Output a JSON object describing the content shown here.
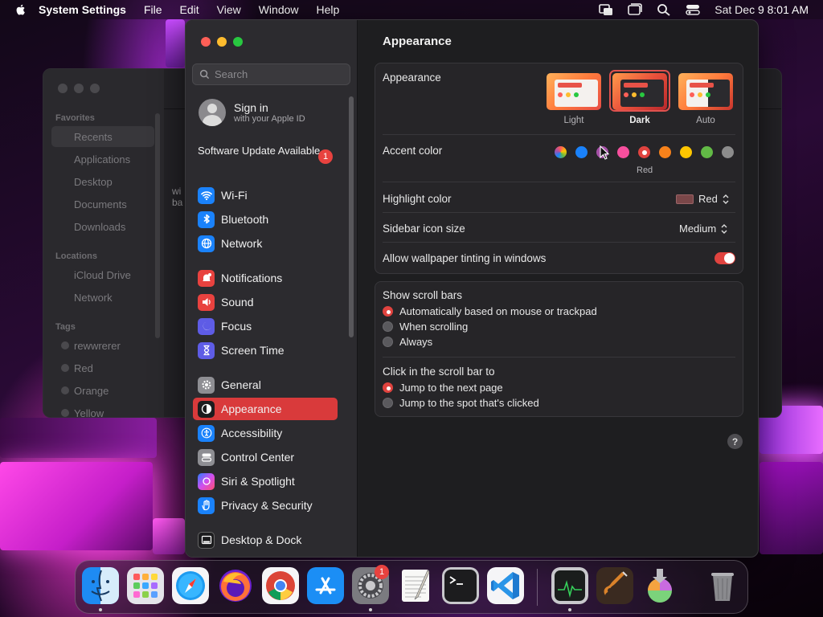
{
  "menubar": {
    "app_name": "System Settings",
    "menus": [
      "File",
      "Edit",
      "View",
      "Window",
      "Help"
    ],
    "clock": "Sat Dec 9  8:01 AM"
  },
  "finder": {
    "sections": {
      "favorites": "Favorites",
      "locations": "Locations",
      "tags": "Tags"
    },
    "favorites": [
      "Recents",
      "Applications",
      "Desktop",
      "Documents",
      "Downloads"
    ],
    "locations": [
      "iCloud Drive",
      "Network"
    ],
    "tags": [
      "rewwrerer",
      "Red",
      "Orange",
      "Yellow"
    ],
    "content_fragment": [
      "wi",
      "ba"
    ]
  },
  "settings": {
    "search": {
      "placeholder": "Search"
    },
    "account": {
      "title": "Sign in",
      "subtitle": "with your Apple ID"
    },
    "software_update": {
      "label": "Software Update Available",
      "badge": "1"
    },
    "sidebar": {
      "items": [
        {
          "label": "Wi-Fi",
          "icon": "wifi-icon",
          "color": "#1a82fb"
        },
        {
          "label": "Bluetooth",
          "icon": "bluetooth-icon",
          "color": "#1a82fb"
        },
        {
          "label": "Network",
          "icon": "globe-icon",
          "color": "#1a82fb"
        },
        {
          "label": "Notifications",
          "icon": "bell-icon",
          "color": "#e8423f"
        },
        {
          "label": "Sound",
          "icon": "speaker-icon",
          "color": "#e8423f"
        },
        {
          "label": "Focus",
          "icon": "moon-icon",
          "color": "#5e5ce6"
        },
        {
          "label": "Screen Time",
          "icon": "hourglass-icon",
          "color": "#5e5ce6"
        },
        {
          "label": "General",
          "icon": "gear-icon",
          "color": "#8e8e93"
        },
        {
          "label": "Appearance",
          "icon": "appearance-icon",
          "color": "#1c1c1e",
          "selected": true
        },
        {
          "label": "Accessibility",
          "icon": "accessibility-icon",
          "color": "#1a82fb"
        },
        {
          "label": "Control Center",
          "icon": "control-center-icon",
          "color": "#8e8e93"
        },
        {
          "label": "Siri & Spotlight",
          "icon": "siri-icon",
          "color": "#b04cd9"
        },
        {
          "label": "Privacy & Security",
          "icon": "hand-icon",
          "color": "#1a82fb"
        },
        {
          "label": "Desktop & Dock",
          "icon": "dock-icon",
          "color": "#1c1c1e"
        }
      ]
    },
    "pane": {
      "title": "Appearance",
      "appearance_label": "Appearance",
      "appearance_options": [
        "Light",
        "Dark",
        "Auto"
      ],
      "appearance_selected": "Dark",
      "accent_label": "Accent color",
      "accent_colors": [
        "multicolor",
        "#1a82fb",
        "#a550a7",
        "#f74f9e",
        "#e0433f",
        "#f7821b",
        "#ffc600",
        "#62ba46",
        "#8c8c8c"
      ],
      "accent_selected_name": "Red",
      "highlight_label": "Highlight color",
      "highlight_value": "Red",
      "sidebar_icon_label": "Sidebar icon size",
      "sidebar_icon_value": "Medium",
      "wallpaper_tint_label": "Allow wallpaper tinting in windows",
      "wallpaper_tint_on": true,
      "scroll_bars_label": "Show scroll bars",
      "scroll_bar_options": [
        "Automatically based on mouse or trackpad",
        "When scrolling",
        "Always"
      ],
      "scroll_bar_selected": 0,
      "click_label": "Click in the scroll bar to",
      "click_options": [
        "Jump to the next page",
        "Jump to the spot that's clicked"
      ],
      "click_selected": 0,
      "help": "?"
    }
  },
  "dock": {
    "apps": [
      "Finder",
      "Launchpad",
      "Safari",
      "Firefox",
      "Chrome",
      "App Store",
      "System Settings",
      "TextEdit",
      "Terminal",
      "Visual Studio Code",
      "Activity Monitor",
      "GarageBand",
      "Disk Utility",
      "Trash"
    ],
    "settings_badge": "1"
  }
}
